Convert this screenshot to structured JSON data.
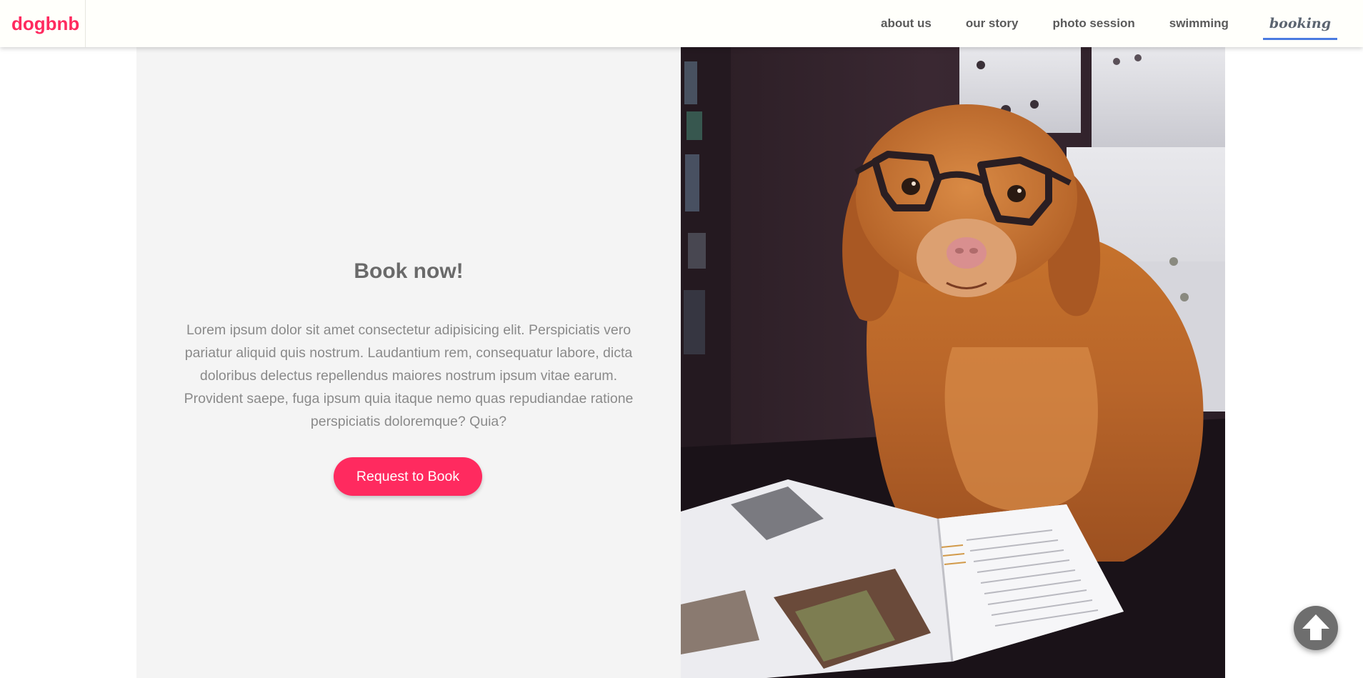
{
  "brand": {
    "name": "dogbnb",
    "color": "#ff2a5f"
  },
  "nav": {
    "items": [
      {
        "label": "about us",
        "active": false
      },
      {
        "label": "our story",
        "active": false
      },
      {
        "label": "photo session",
        "active": false
      },
      {
        "label": "swimming",
        "active": false
      },
      {
        "label": "booking",
        "active": true
      }
    ],
    "active_underline_color": "#4a7be0"
  },
  "booking": {
    "heading": "Book now!",
    "description": "Lorem ipsum dolor sit amet consectetur adipisicing elit. Perspiciatis vero pariatur aliquid quis nostrum. Laudantium rem, consequatur labore, dicta doloribus delectus repellendus maiores nostrum ipsum vitae earum. Provident saepe, fuga ipsum quia itaque nemo quas repudiandae ratione perspiciatis doloremque? Quia?",
    "button_label": "Request to Book",
    "button_color": "#ff2a5f"
  },
  "photo": {
    "subject": "golden retriever wearing glasses beside an open magazine"
  },
  "scroll_top": {
    "icon": "arrow-up-icon"
  }
}
